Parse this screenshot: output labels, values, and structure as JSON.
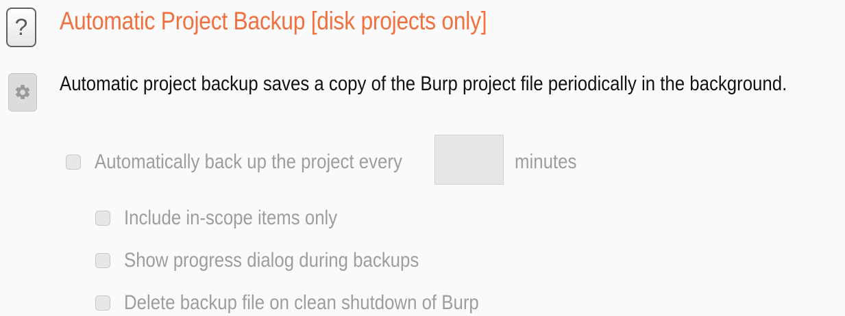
{
  "toolbar": {
    "help_icon": "question-mark-icon",
    "help_glyph": "?",
    "settings_icon": "gear-icon"
  },
  "section": {
    "title": "Automatic Project Backup [disk projects only]",
    "description": "Automatic project backup saves a copy of the Burp project file periodically in the background."
  },
  "options": {
    "auto_backup": {
      "label": "Automatically back up the project every",
      "checked": false
    },
    "interval_minutes": {
      "value": "",
      "unit_label": "minutes"
    },
    "in_scope_only": {
      "label": "Include in-scope items only",
      "checked": false
    },
    "show_progress": {
      "label": "Show progress dialog during backups",
      "checked": false
    },
    "delete_on_shutdown": {
      "label": "Delete backup file on clean shutdown of Burp",
      "checked": false
    }
  },
  "colors": {
    "title": "#f0703f",
    "disabled_text": "#9d9d9d",
    "background": "#fafafa"
  }
}
